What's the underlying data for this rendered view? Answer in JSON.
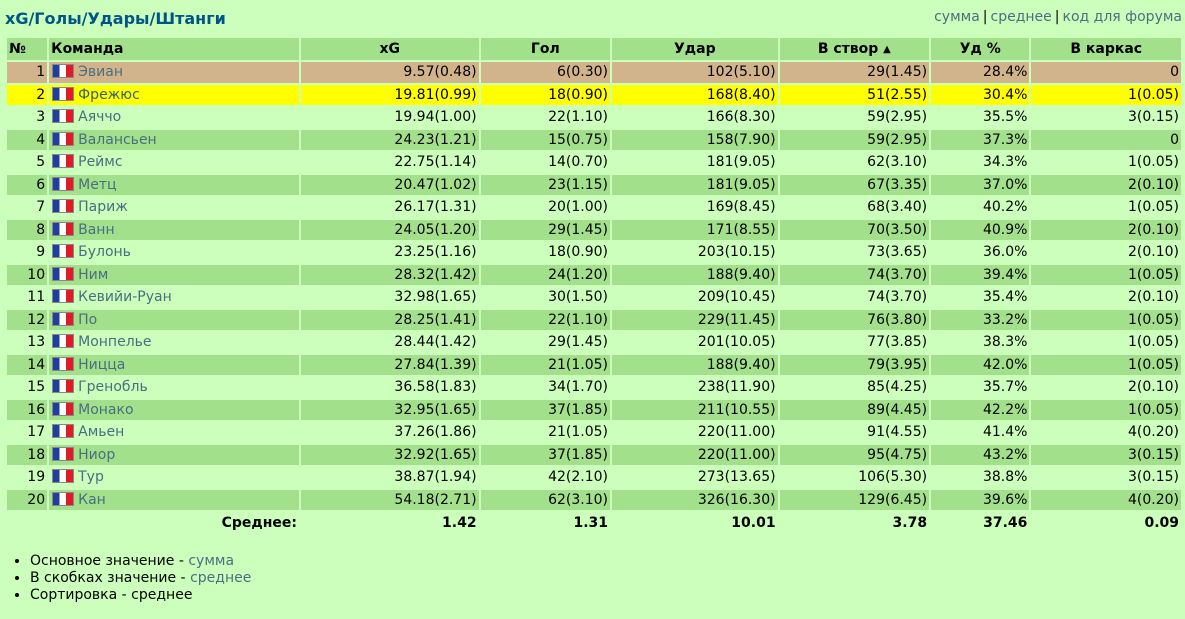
{
  "page_title": "xG/Голы/Удары/Штанги",
  "view_links": {
    "sum": "сумма",
    "avg": "среднее",
    "forum_code": "код для форума",
    "separator": "|"
  },
  "table": {
    "headers": {
      "num": "№",
      "team": "Команда",
      "xg": "xG",
      "goals": "Гол",
      "shots": "Удар",
      "on_target": "В створ",
      "shot_pct": "Уд %",
      "woodwork": "В каркас"
    },
    "sort_indicator": "▲",
    "rows": [
      {
        "num": "1",
        "team": "Эвиан",
        "xg": "9.57(0.48)",
        "goals": "6(0.30)",
        "shots": "102(5.10)",
        "on_target": "29(1.45)",
        "shot_pct": "28.4%",
        "woodwork": "0",
        "highlight": "tan"
      },
      {
        "num": "2",
        "team": "Фрежюс",
        "xg": "19.81(0.99)",
        "goals": "18(0.90)",
        "shots": "168(8.40)",
        "on_target": "51(2.55)",
        "shot_pct": "30.4%",
        "woodwork": "1(0.05)",
        "highlight": "yellow"
      },
      {
        "num": "3",
        "team": "Аяччо",
        "xg": "19.94(1.00)",
        "goals": "22(1.10)",
        "shots": "166(8.30)",
        "on_target": "59(2.95)",
        "shot_pct": "35.5%",
        "woodwork": "3(0.15)",
        "highlight": ""
      },
      {
        "num": "4",
        "team": "Валансьен",
        "xg": "24.23(1.21)",
        "goals": "15(0.75)",
        "shots": "158(7.90)",
        "on_target": "59(2.95)",
        "shot_pct": "37.3%",
        "woodwork": "0",
        "highlight": ""
      },
      {
        "num": "5",
        "team": "Реймс",
        "xg": "22.75(1.14)",
        "goals": "14(0.70)",
        "shots": "181(9.05)",
        "on_target": "62(3.10)",
        "shot_pct": "34.3%",
        "woodwork": "1(0.05)",
        "highlight": ""
      },
      {
        "num": "6",
        "team": "Метц",
        "xg": "20.47(1.02)",
        "goals": "23(1.15)",
        "shots": "181(9.05)",
        "on_target": "67(3.35)",
        "shot_pct": "37.0%",
        "woodwork": "2(0.10)",
        "highlight": ""
      },
      {
        "num": "7",
        "team": "Париж",
        "xg": "26.17(1.31)",
        "goals": "20(1.00)",
        "shots": "169(8.45)",
        "on_target": "68(3.40)",
        "shot_pct": "40.2%",
        "woodwork": "1(0.05)",
        "highlight": ""
      },
      {
        "num": "8",
        "team": "Ванн",
        "xg": "24.05(1.20)",
        "goals": "29(1.45)",
        "shots": "171(8.55)",
        "on_target": "70(3.50)",
        "shot_pct": "40.9%",
        "woodwork": "2(0.10)",
        "highlight": ""
      },
      {
        "num": "9",
        "team": "Булонь",
        "xg": "23.25(1.16)",
        "goals": "18(0.90)",
        "shots": "203(10.15)",
        "on_target": "73(3.65)",
        "shot_pct": "36.0%",
        "woodwork": "2(0.10)",
        "highlight": ""
      },
      {
        "num": "10",
        "team": "Ним",
        "xg": "28.32(1.42)",
        "goals": "24(1.20)",
        "shots": "188(9.40)",
        "on_target": "74(3.70)",
        "shot_pct": "39.4%",
        "woodwork": "1(0.05)",
        "highlight": ""
      },
      {
        "num": "11",
        "team": "Кевийи-Руан",
        "xg": "32.98(1.65)",
        "goals": "30(1.50)",
        "shots": "209(10.45)",
        "on_target": "74(3.70)",
        "shot_pct": "35.4%",
        "woodwork": "2(0.10)",
        "highlight": ""
      },
      {
        "num": "12",
        "team": "По",
        "xg": "28.25(1.41)",
        "goals": "22(1.10)",
        "shots": "229(11.45)",
        "on_target": "76(3.80)",
        "shot_pct": "33.2%",
        "woodwork": "1(0.05)",
        "highlight": ""
      },
      {
        "num": "13",
        "team": "Монпелье",
        "xg": "28.44(1.42)",
        "goals": "29(1.45)",
        "shots": "201(10.05)",
        "on_target": "77(3.85)",
        "shot_pct": "38.3%",
        "woodwork": "1(0.05)",
        "highlight": ""
      },
      {
        "num": "14",
        "team": "Ницца",
        "xg": "27.84(1.39)",
        "goals": "21(1.05)",
        "shots": "188(9.40)",
        "on_target": "79(3.95)",
        "shot_pct": "42.0%",
        "woodwork": "1(0.05)",
        "highlight": ""
      },
      {
        "num": "15",
        "team": "Гренобль",
        "xg": "36.58(1.83)",
        "goals": "34(1.70)",
        "shots": "238(11.90)",
        "on_target": "85(4.25)",
        "shot_pct": "35.7%",
        "woodwork": "2(0.10)",
        "highlight": ""
      },
      {
        "num": "16",
        "team": "Монако",
        "xg": "32.95(1.65)",
        "goals": "37(1.85)",
        "shots": "211(10.55)",
        "on_target": "89(4.45)",
        "shot_pct": "42.2%",
        "woodwork": "1(0.05)",
        "highlight": ""
      },
      {
        "num": "17",
        "team": "Амьен",
        "xg": "37.26(1.86)",
        "goals": "21(1.05)",
        "shots": "220(11.00)",
        "on_target": "91(4.55)",
        "shot_pct": "41.4%",
        "woodwork": "4(0.20)",
        "highlight": ""
      },
      {
        "num": "18",
        "team": "Ниор",
        "xg": "32.92(1.65)",
        "goals": "37(1.85)",
        "shots": "220(11.00)",
        "on_target": "95(4.75)",
        "shot_pct": "43.2%",
        "woodwork": "3(0.15)",
        "highlight": ""
      },
      {
        "num": "19",
        "team": "Тур",
        "xg": "38.87(1.94)",
        "goals": "42(2.10)",
        "shots": "273(13.65)",
        "on_target": "106(5.30)",
        "shot_pct": "38.8%",
        "woodwork": "3(0.15)",
        "highlight": ""
      },
      {
        "num": "20",
        "team": "Кан",
        "xg": "54.18(2.71)",
        "goals": "62(3.10)",
        "shots": "326(16.30)",
        "on_target": "129(6.45)",
        "shot_pct": "39.6%",
        "woodwork": "4(0.20)",
        "highlight": ""
      }
    ],
    "footer": {
      "label": "Среднее:",
      "xg": "1.42",
      "goals": "1.31",
      "shots": "10.01",
      "on_target": "3.78",
      "shot_pct": "37.46",
      "woodwork": "0.09"
    }
  },
  "notes": [
    {
      "text": "Основное значение - ",
      "link": "сумма"
    },
    {
      "text": "В скобках значение - ",
      "link": "среднее"
    },
    {
      "text": "Сортировка - среднее",
      "link": ""
    }
  ],
  "colors": {
    "background": "#ccffbb",
    "row_alt": "#a3e08b",
    "highlight_tan": "#d2b48c",
    "highlight_yellow": "#ffff00",
    "title": "#005588",
    "link": "#4a7080"
  },
  "icons": {
    "team_flag": "france-flag-icon"
  }
}
